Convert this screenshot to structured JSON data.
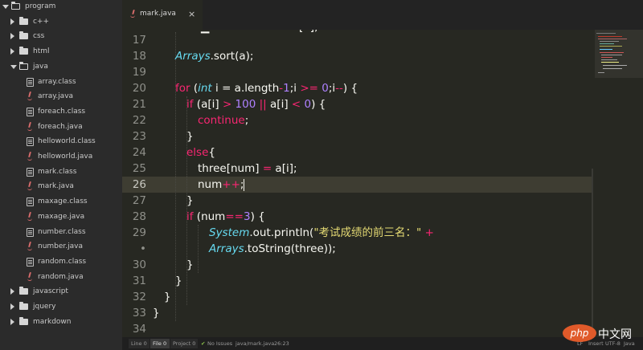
{
  "sidebar": {
    "items": [
      {
        "label": "program",
        "type": "folder-open",
        "depth": 0
      },
      {
        "label": "c++",
        "type": "folder",
        "depth": 1
      },
      {
        "label": "css",
        "type": "folder",
        "depth": 1
      },
      {
        "label": "html",
        "type": "folder",
        "depth": 1
      },
      {
        "label": "java",
        "type": "folder-open",
        "depth": 1
      },
      {
        "label": "array.class",
        "type": "file",
        "depth": 2
      },
      {
        "label": "array.java",
        "type": "java",
        "depth": 2
      },
      {
        "label": "foreach.class",
        "type": "file",
        "depth": 2
      },
      {
        "label": "foreach.java",
        "type": "java",
        "depth": 2
      },
      {
        "label": "helloworld.class",
        "type": "file",
        "depth": 2
      },
      {
        "label": "helloworld.java",
        "type": "java",
        "depth": 2
      },
      {
        "label": "mark.class",
        "type": "file",
        "depth": 2
      },
      {
        "label": "mark.java",
        "type": "java",
        "depth": 2
      },
      {
        "label": "maxage.class",
        "type": "file",
        "depth": 2
      },
      {
        "label": "maxage.java",
        "type": "java",
        "depth": 2
      },
      {
        "label": "number.class",
        "type": "file",
        "depth": 2
      },
      {
        "label": "number.java",
        "type": "java",
        "depth": 2
      },
      {
        "label": "random.class",
        "type": "file",
        "depth": 2
      },
      {
        "label": "random.java",
        "type": "java",
        "depth": 2
      },
      {
        "label": "javascript",
        "type": "folder",
        "depth": 1
      },
      {
        "label": "jquery",
        "type": "folder",
        "depth": 1
      },
      {
        "label": "markdown",
        "type": "folder",
        "depth": 1
      }
    ]
  },
  "tab": {
    "label": "mark.java",
    "close": "×"
  },
  "editor": {
    "line_numbers": [
      "17",
      "18",
      "19",
      "20",
      "21",
      "22",
      "23",
      "24",
      "25",
      "26",
      "27",
      "28",
      "29",
      "•",
      "30",
      "31",
      "32",
      "33",
      "34"
    ],
    "active_line": "26"
  },
  "code": {
    "l18": {
      "cls": "Arrays",
      "rest": ".sort(a);"
    },
    "l20": {
      "kw": "for",
      "p1": " (",
      "t": "int",
      "p2": " i = a.length",
      "op1": "-",
      "n1": "1",
      ";": ";i ",
      ">=": ">=",
      "sp": " ",
      "n0": "0",
      ";2": ";i",
      "dec": "--",
      ") {": ") {"
    },
    "l21": {
      "kw": "if",
      "a": " (a[i] ",
      "gt": ">",
      "sp": " ",
      "n": "100",
      "sp2": " ",
      "or": "||",
      "b": " a[i] ",
      "lt": "<",
      "sp3": " ",
      "n0": "0",
      ")": ") {"
    },
    "l22": {
      "kw": "continue",
      ";": ";"
    },
    "l23": {
      "t": "}"
    },
    "l24": {
      "kw": "else",
      "t": "{"
    },
    "l25": {
      "a": "three[num] ",
      "eq": "=",
      "b": " a[i];"
    },
    "l26": {
      "a": "num",
      "inc": "++",
      ";": ";"
    },
    "l27": {
      "t": "}"
    },
    "l28": {
      "kw": "if",
      "a": " (num",
      "eq": "==",
      "n": "3",
      ")": ") {"
    },
    "l29": {
      "cls": "System",
      "a": ".out.println(",
      "str": "\"考试成绩的前三名：\"",
      "sp": " ",
      "plus": "+"
    },
    "l29b": {
      "cls": "Arrays",
      "a": ".toString(three));"
    },
    "l30": {
      "t": "}"
    },
    "l31": {
      "t": "}"
    },
    "l32": {
      "t": "}"
    },
    "l33": {
      "t": "}"
    },
    "l16": {
      "t": "[].",
      "kw": ""
    }
  },
  "statusbar": {
    "line": "Line 0",
    "file": "File 0",
    "project": "Project 0",
    "issues": "No Issues",
    "path": "java/mark.java",
    "pos": "26:23",
    "eol": "LF",
    "mode": "Insert",
    "encoding": "UTF-8",
    "lang": "Java"
  },
  "watermark": {
    "logo": "php",
    "text": "中文网"
  },
  "colors": {
    "keyword": "#f92672",
    "type": "#66d9ef",
    "number": "#ae81ff",
    "string": "#e6db74",
    "text": "#f8f8f2",
    "background": "#272822"
  }
}
